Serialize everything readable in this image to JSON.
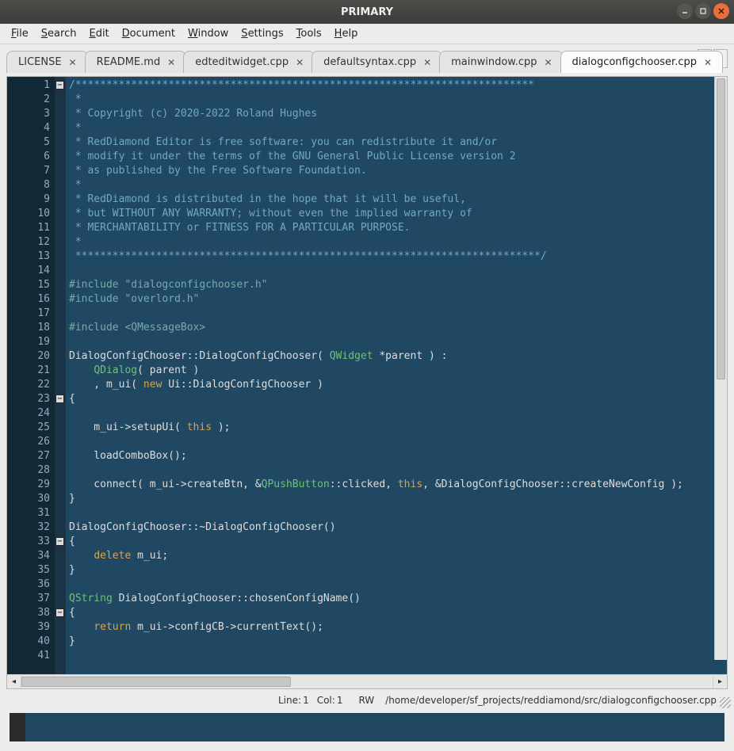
{
  "window": {
    "title": "PRIMARY"
  },
  "menus": [
    "File",
    "Search",
    "Edit",
    "Document",
    "Window",
    "Settings",
    "Tools",
    "Help"
  ],
  "tabs": [
    {
      "label": "LICENSE",
      "active": false
    },
    {
      "label": "README.md",
      "active": false
    },
    {
      "label": "edteditwidget.cpp",
      "active": false
    },
    {
      "label": "defaultsyntax.cpp",
      "active": false
    },
    {
      "label": "mainwindow.cpp",
      "active": false
    },
    {
      "label": "dialogconfigchooser.cpp",
      "active": true
    }
  ],
  "status": {
    "line_label": "Line:",
    "line": "1",
    "col_label": "Col:",
    "col": "1",
    "mode": "RW",
    "path": "/home/developer/sf_projects/reddiamond/src/dialogconfigchooser.cpp"
  },
  "code_lines": [
    {
      "n": 1,
      "cls": "c-comment",
      "text": "/**************************************************************************"
    },
    {
      "n": 2,
      "cls": "c-comment",
      "text": " *"
    },
    {
      "n": 3,
      "cls": "c-comment",
      "text": " * Copyright (c) 2020-2022 Roland Hughes"
    },
    {
      "n": 4,
      "cls": "c-comment",
      "text": " *"
    },
    {
      "n": 5,
      "cls": "c-comment",
      "text": " * RedDiamond Editor is free software: you can redistribute it and/or"
    },
    {
      "n": 6,
      "cls": "c-comment",
      "text": " * modify it under the terms of the GNU General Public License version 2"
    },
    {
      "n": 7,
      "cls": "c-comment",
      "text": " * as published by the Free Software Foundation."
    },
    {
      "n": 8,
      "cls": "c-comment",
      "text": " *"
    },
    {
      "n": 9,
      "cls": "c-comment",
      "text": " * RedDiamond is distributed in the hope that it will be useful,"
    },
    {
      "n": 10,
      "cls": "c-comment",
      "text": " * but WITHOUT ANY WARRANTY; without even the implied warranty of"
    },
    {
      "n": 11,
      "cls": "c-comment",
      "text": " * MERCHANTABILITY or FITNESS FOR A PARTICULAR PURPOSE."
    },
    {
      "n": 12,
      "cls": "c-comment",
      "text": " *"
    },
    {
      "n": 13,
      "cls": "c-comment",
      "text": " ***************************************************************************/"
    },
    {
      "n": 14,
      "cls": "",
      "text": ""
    },
    {
      "n": 15,
      "cls": "",
      "html": "<span class='c-pp'>#include</span> <span class='c-str'>\"dialogconfigchooser.h\"</span>"
    },
    {
      "n": 16,
      "cls": "",
      "html": "<span class='c-pp'>#include</span> <span class='c-str'>\"overlord.h\"</span>"
    },
    {
      "n": 17,
      "cls": "",
      "text": ""
    },
    {
      "n": 18,
      "cls": "",
      "html": "<span class='c-pp'>#include</span> <span class='c-str'>&lt;QMessageBox&gt;</span>"
    },
    {
      "n": 19,
      "cls": "",
      "text": ""
    },
    {
      "n": 20,
      "cls": "",
      "html": "DialogConfigChooser::DialogConfigChooser( <span class='c-type'>QWidget</span> *parent ) :"
    },
    {
      "n": 21,
      "cls": "",
      "html": "    <span class='c-type'>QDialog</span>( parent )"
    },
    {
      "n": 22,
      "cls": "",
      "html": "    , m_ui( <span class='c-kw'>new</span> Ui::DialogConfigChooser )"
    },
    {
      "n": 23,
      "cls": "",
      "text": "{"
    },
    {
      "n": 24,
      "cls": "",
      "text": ""
    },
    {
      "n": 25,
      "cls": "",
      "html": "    m_ui-&gt;setupUi( <span class='c-kw'>this</span> );"
    },
    {
      "n": 26,
      "cls": "",
      "text": ""
    },
    {
      "n": 27,
      "cls": "",
      "text": "    loadComboBox();"
    },
    {
      "n": 28,
      "cls": "",
      "text": ""
    },
    {
      "n": 29,
      "cls": "",
      "html": "    connect( m_ui-&gt;createBtn, &amp;<span class='c-type'>QPushButton</span>::clicked, <span class='c-kw'>this</span>, &amp;DialogConfigChooser::createNewConfig );"
    },
    {
      "n": 30,
      "cls": "",
      "text": "}"
    },
    {
      "n": 31,
      "cls": "",
      "text": ""
    },
    {
      "n": 32,
      "cls": "",
      "text": "DialogConfigChooser::~DialogConfigChooser()"
    },
    {
      "n": 33,
      "cls": "",
      "text": "{"
    },
    {
      "n": 34,
      "cls": "",
      "html": "    <span class='c-kw'>delete</span> m_ui;"
    },
    {
      "n": 35,
      "cls": "",
      "text": "}"
    },
    {
      "n": 36,
      "cls": "",
      "text": ""
    },
    {
      "n": 37,
      "cls": "",
      "html": "<span class='c-type'>QString</span> DialogConfigChooser::chosenConfigName()"
    },
    {
      "n": 38,
      "cls": "",
      "text": "{"
    },
    {
      "n": 39,
      "cls": "",
      "html": "    <span class='c-kw'>return</span> m_ui-&gt;configCB-&gt;currentText();"
    },
    {
      "n": 40,
      "cls": "",
      "text": "}"
    },
    {
      "n": 41,
      "cls": "",
      "text": ""
    }
  ],
  "fold_marks": [
    1,
    23,
    33,
    38
  ]
}
